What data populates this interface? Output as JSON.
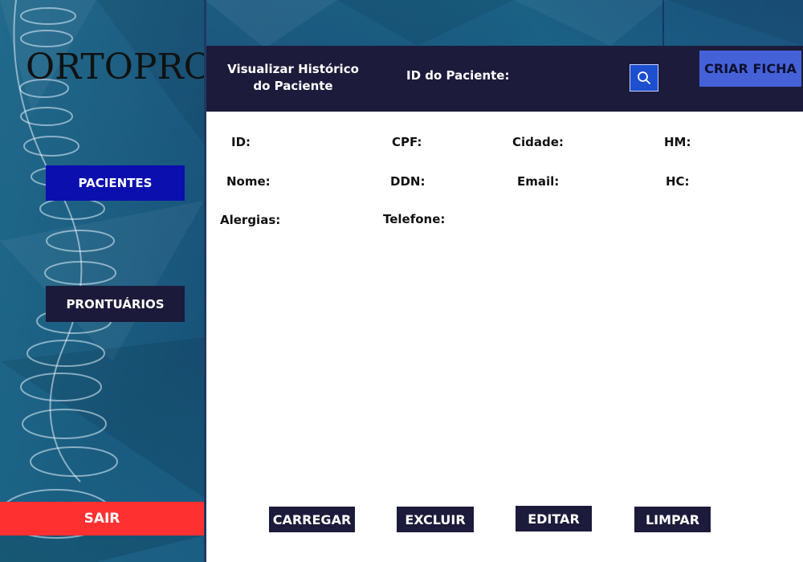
{
  "app": {
    "logo": "ORTOPRO"
  },
  "sidebar": {
    "items": [
      {
        "label": "PACIENTES"
      },
      {
        "label": "PRONTUÁRIOS"
      }
    ],
    "logout_label": "SAIR"
  },
  "header": {
    "title": "Visualizar Histórico do Paciente",
    "id_label": "ID do Paciente:",
    "id_value": "",
    "search_icon": "search-icon",
    "create_label": "CRIAR FICHA"
  },
  "fields": {
    "id": "ID:",
    "cpf": "CPF:",
    "cidade": "Cidade:",
    "hm": "HM:",
    "nome": "Nome:",
    "ddn": "DDN:",
    "email": "Email:",
    "hc": "HC:",
    "alergias": "Alergias:",
    "telefone": "Telefone:"
  },
  "actions": {
    "carregar": "CARREGAR",
    "excluir": "EXCLUIR",
    "editar": "EDITAR",
    "limpar": "LIMPAR"
  },
  "colors": {
    "accent": "#0b0fae",
    "header_bg": "#1c1b3b",
    "danger": "#ff3030",
    "create_button": "#4561d8"
  }
}
